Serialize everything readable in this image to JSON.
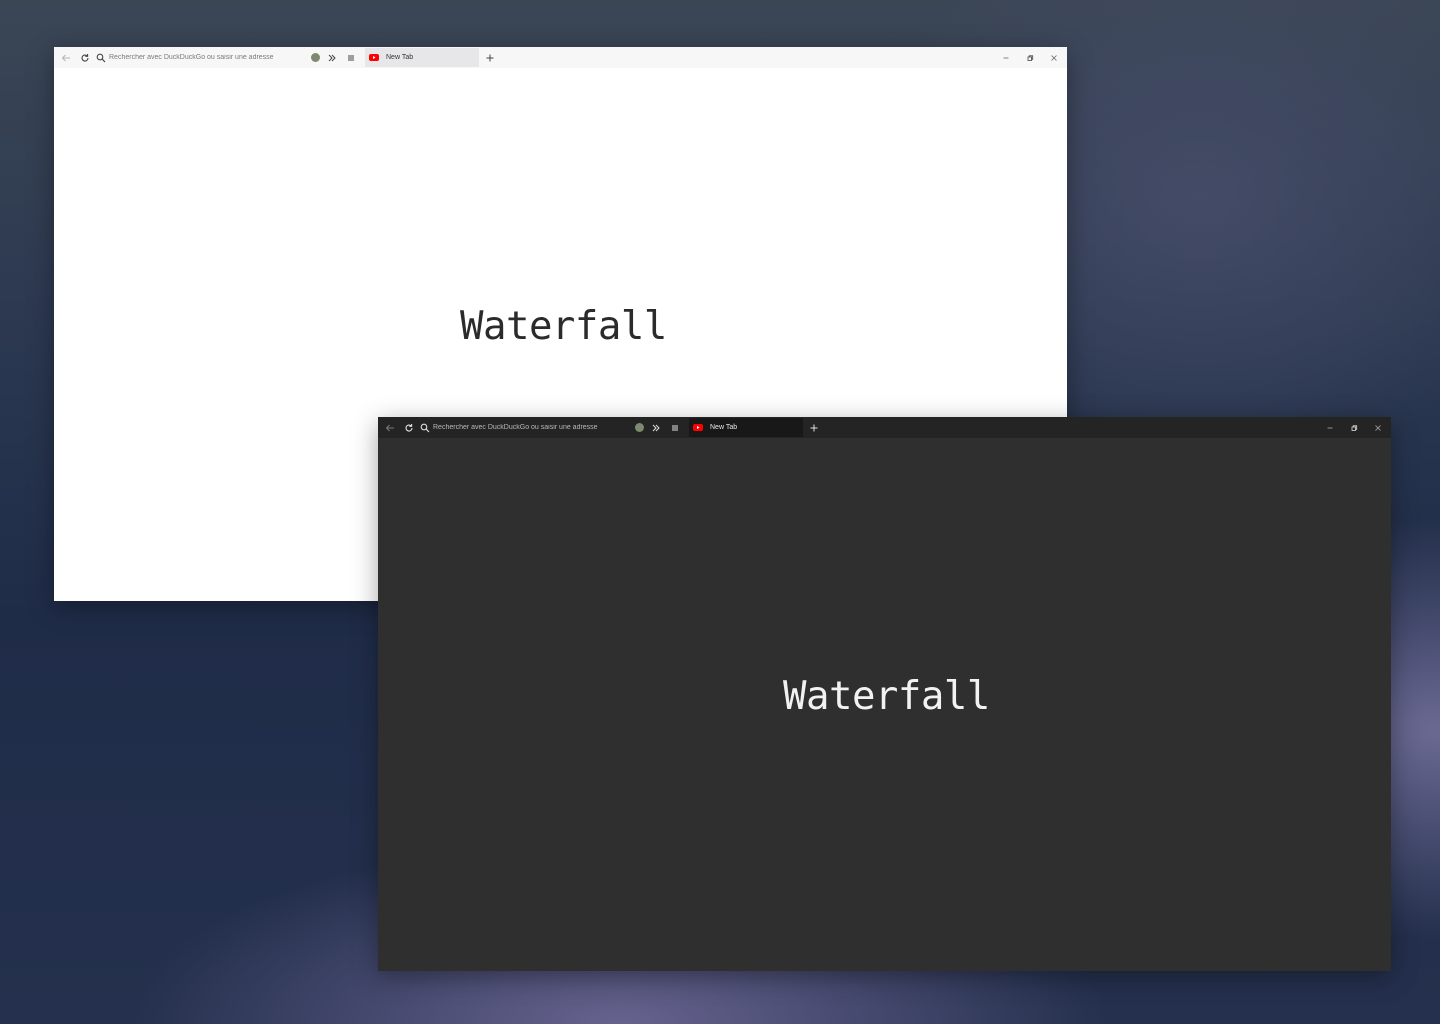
{
  "windows": [
    {
      "id": "light",
      "theme": "light",
      "url_placeholder": "Rechercher avec DuckDuckGo ou saisir une adresse",
      "tab_title": "New Tab",
      "page_heading": "Waterfall"
    },
    {
      "id": "dark",
      "theme": "dark",
      "url_placeholder": "Rechercher avec DuckDuckGo ou saisir une adresse",
      "tab_title": "New Tab",
      "page_heading": "Waterfall"
    }
  ],
  "icons": {
    "back": "arrow-left-icon",
    "reload": "reload-icon",
    "search": "search-icon",
    "extension": "extension-dot-icon",
    "overflow": "chevrons-right-icon",
    "menu": "hamburger-icon",
    "tab_favicon": "youtube-icon",
    "new_tab": "plus-icon",
    "minimize": "minimize-icon",
    "restore": "restore-icon",
    "close": "close-icon"
  },
  "colors": {
    "light_window_bg": "#ffffff",
    "dark_window_bg": "#2f2f2f",
    "extension_dot": "#7d8a6f",
    "youtube_red": "#ff0000"
  }
}
